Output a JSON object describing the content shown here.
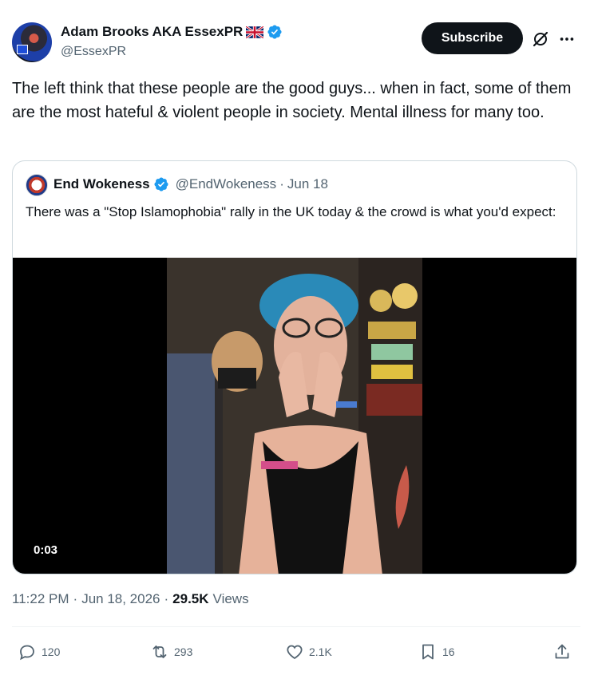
{
  "author": {
    "display_name": "Adam Brooks AKA EssexPR",
    "handle": "@EssexPR",
    "flag_icon": "uk-flag-icon",
    "verified_icon": "verified-badge-icon"
  },
  "header": {
    "subscribe_label": "Subscribe",
    "grok_icon": "grok-icon",
    "more_icon": "more-icon"
  },
  "tweet": {
    "text": "The left think that these people are the good guys... when in fact, some of them are the most hateful & violent people in society. Mental illness for many too."
  },
  "quote": {
    "display_name": "End Wokeness",
    "handle": "@EndWokeness",
    "separator": "·",
    "date": "Jun 18",
    "text": "There was a \"Stop Islamophobia\" rally in the UK today & the crowd is what you'd expect:",
    "video_duration": "0:03"
  },
  "meta": {
    "time": "11:22 PM",
    "sep1": "·",
    "date": "Jun 18, 2026",
    "sep2": "·",
    "views_count": "29.5K",
    "views_label": "Views"
  },
  "actions": {
    "replies": "120",
    "reposts": "293",
    "likes": "2.1K",
    "bookmarks": "16"
  },
  "colors": {
    "text": "#0f1419",
    "secondary": "#536471",
    "verified": "#1d9bf0",
    "border": "#cfd9de"
  }
}
